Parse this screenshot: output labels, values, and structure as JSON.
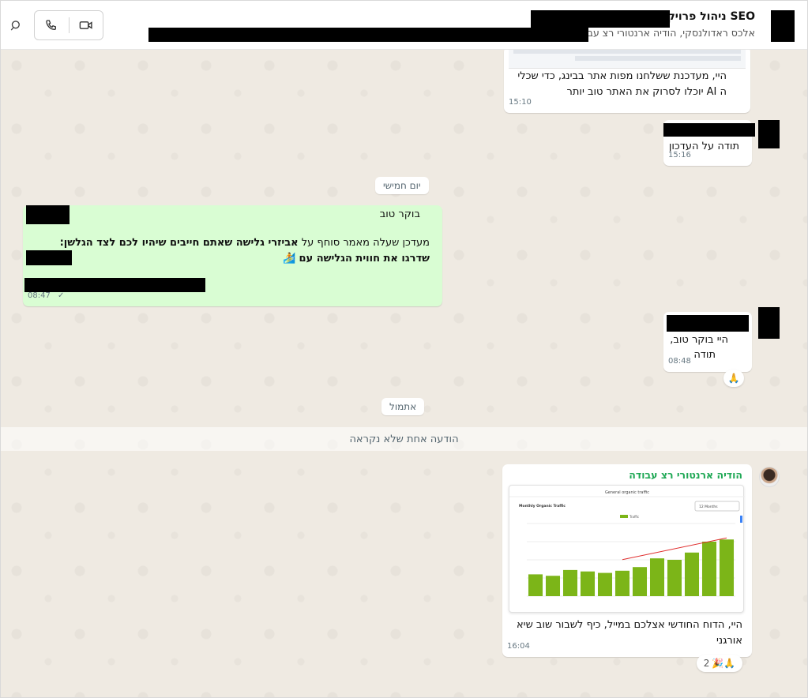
{
  "header": {
    "title": "SEO ניהול פרויקט -",
    "subtitle": "אלכס ראדולנסקי, הודיה ארנטורי רצ עב",
    "icons": [
      "search-icon",
      "phone-icon",
      "video-icon"
    ]
  },
  "messages": [
    {
      "id": "m1",
      "direction": "incoming",
      "text": "היי, מעדכנת ששלחנו מפות אתר בבינג, כדי שכלי ה AI יוכלו לסרוק את האתר טוב יותר",
      "time": "15:10"
    },
    {
      "id": "m2",
      "direction": "incoming",
      "text": "תודה על העדכון",
      "time": "15:16"
    },
    {
      "id": "m3",
      "direction": "outgoing",
      "greeting": "בוקר טוב",
      "text_plain": "מעדכן שעלה מאמר סוחף על",
      "text_bold": "אביזרי גלישה שאתם חייבים שיהיו לכם לצד הגלשן: שדרגו את חווית הגלישה עם",
      "emoji": "🏄",
      "time": "08:47",
      "status": "✓"
    },
    {
      "id": "m4",
      "direction": "incoming",
      "line1": "היי בוקר טוב,",
      "line2": "תודה",
      "time": "08:48",
      "reaction": "🙏"
    },
    {
      "id": "m5",
      "direction": "incoming",
      "sender": "הודיה ארנטורי רצ עבודה",
      "text": "היי, הדוח החודשי אצלכם במייל, כיף לשבור שוב שיא אורגני",
      "time": "16:04",
      "reactions": "🎉🙏",
      "reaction_count": "2"
    }
  ],
  "dividers": {
    "thursday": "יום חמישי",
    "yesterday": "אתמול",
    "unread": "הודעה אחת שלא נקראה"
  },
  "chart_data": {
    "type": "bar",
    "title": "General organic traffic",
    "subtitle": "Monthly Organic Traffic",
    "dropdown": "12 Months",
    "legend": "Traffic",
    "values": [
      30,
      28,
      36,
      34,
      32,
      35,
      40,
      52,
      50,
      60,
      75,
      78
    ],
    "trendline": true,
    "ylim": [
      0,
      100
    ],
    "colors": {
      "bar": "#7cb518",
      "trend": "#e03030"
    }
  },
  "colors": {
    "outgoing_bubble": "#d9fdd3",
    "incoming_bubble": "#ffffff",
    "sender_name": "#1fa855",
    "chat_bg": "#efeae2"
  }
}
